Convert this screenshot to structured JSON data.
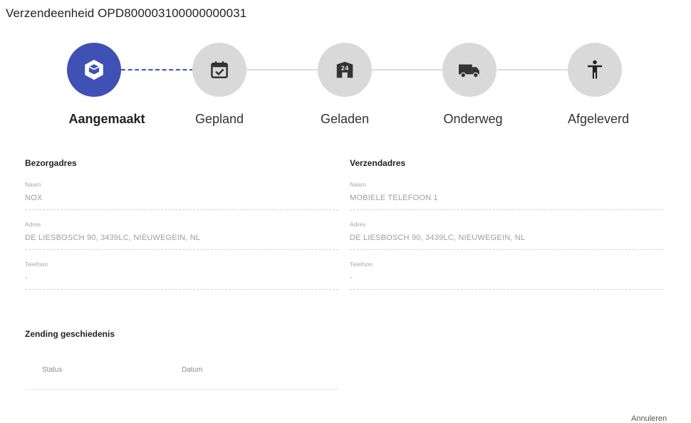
{
  "page_title": "Verzendeenheid OPD800003100000000031",
  "accent_color": "#3f51b5",
  "inactive_color": "#d9d9d9",
  "stepper": {
    "steps": [
      {
        "label": "Aangemaakt",
        "icon": "package-icon",
        "active": true
      },
      {
        "label": "Gepland",
        "icon": "calendar-check-icon",
        "active": false
      },
      {
        "label": "Geladen",
        "icon": "warehouse-24-icon",
        "active": false
      },
      {
        "label": "Onderweg",
        "icon": "truck-icon",
        "active": false
      },
      {
        "label": "Afgeleverd",
        "icon": "person-icon",
        "active": false
      }
    ]
  },
  "bezorgadres": {
    "title": "Bezorgadres",
    "naam_label": "Naam",
    "naam": "NOX",
    "adres_label": "Adres",
    "adres": "DE LIESBOSCH 90, 3439LC, NIEUWEGEIN, NL",
    "telefoon_label": "Telefoon",
    "telefoon": "-"
  },
  "verzendadres": {
    "title": "Verzendadres",
    "naam_label": "Naam",
    "naam": "MOBIELE TELEFOON 1",
    "adres_label": "Adres",
    "adres": "DE LIESBOSCH 90, 3439LC, NIEUWEGEIN, NL",
    "telefoon_label": "Telefoon",
    "telefoon": "-"
  },
  "history": {
    "title": "Zending geschiedenis",
    "columns": [
      "Status",
      "Datum"
    ]
  },
  "cancel_label": "Annuleren"
}
